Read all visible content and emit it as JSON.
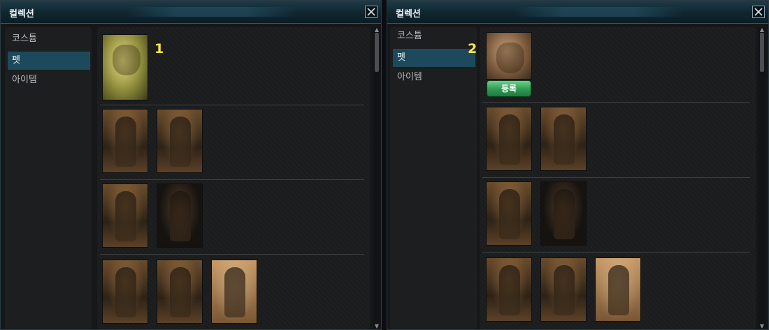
{
  "windows": [
    {
      "title": "컬렉션",
      "sidebar": {
        "items": [
          "코스튬",
          "펫",
          "아이템"
        ],
        "active_index": 1
      },
      "marker": "1",
      "register_button": ""
    },
    {
      "title": "컬렉션",
      "sidebar": {
        "items": [
          "코스튬",
          "펫",
          "아이템"
        ],
        "active_index": 1
      },
      "marker": "2",
      "register_button": "등록"
    }
  ],
  "icons": {
    "close": "close-icon",
    "scroll_up": "chevron-up-icon",
    "scroll_down": "chevron-down-icon"
  },
  "colors": {
    "active_tab": "#1c4a5c",
    "marker": "#ffe54a",
    "register_button": "#2e9a52"
  }
}
